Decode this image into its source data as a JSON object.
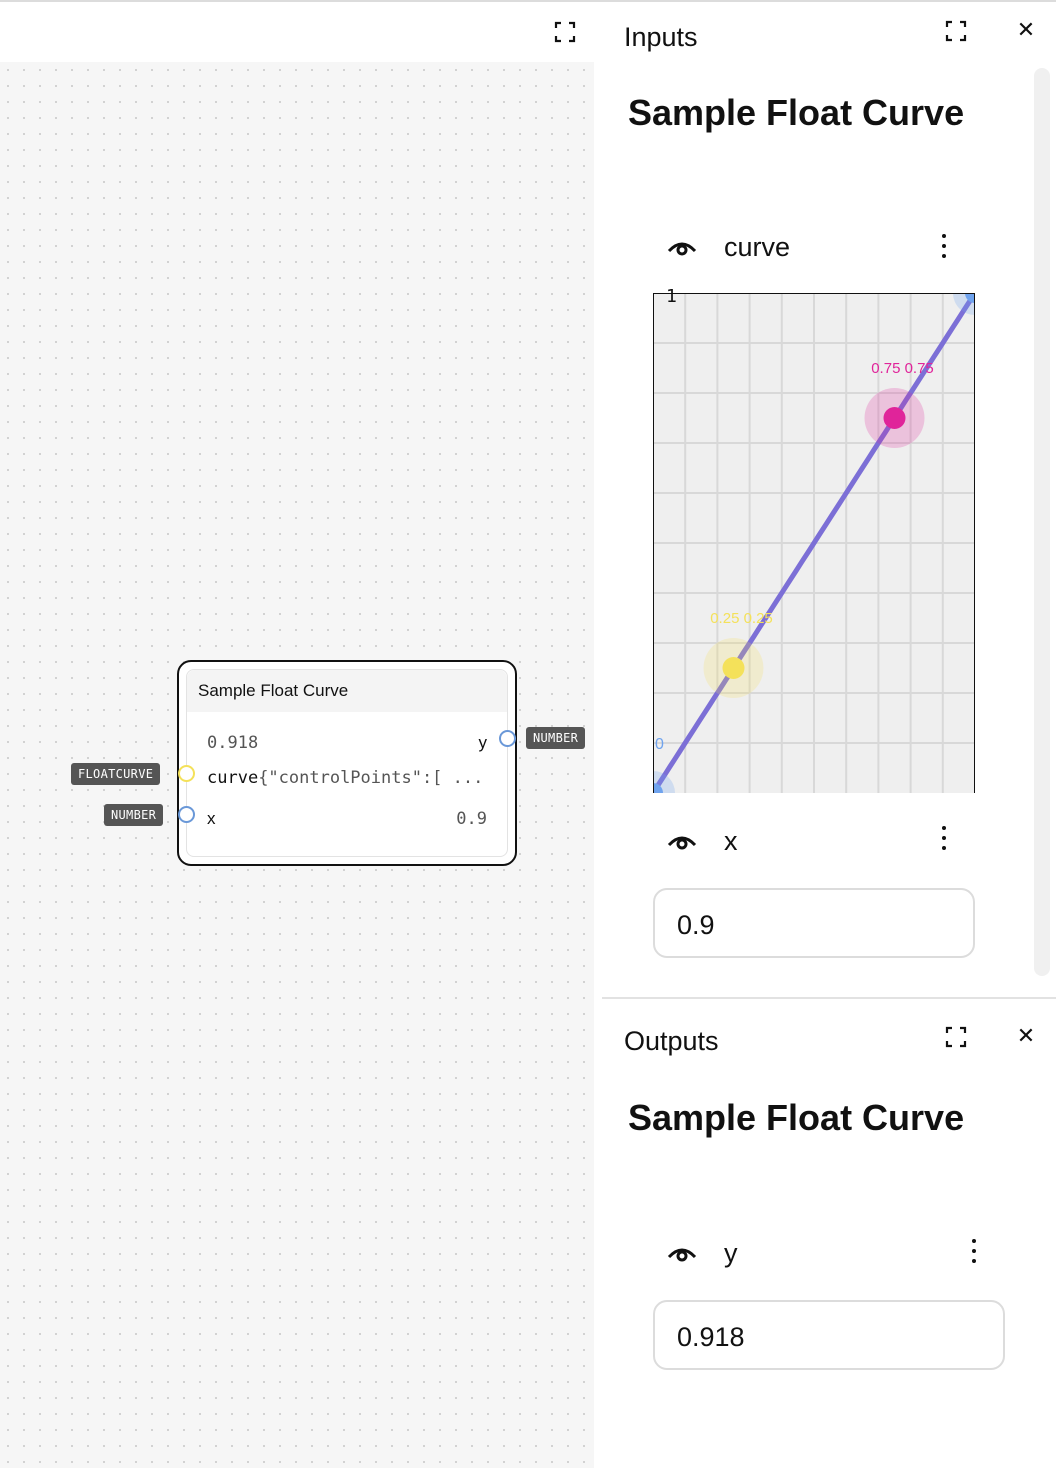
{
  "canvas": {
    "node": {
      "title": "Sample Float Curve",
      "output_value": "0.918",
      "output_name": "y",
      "output_type": "NUMBER",
      "curve_label": "curve",
      "curve_value": "{\"controlPoints\":[ ...",
      "curve_type": "FLOATCURVE",
      "x_label": "x",
      "x_value": "0.9",
      "x_type": "NUMBER"
    }
  },
  "inputs_panel": {
    "title": "Inputs",
    "heading": "Sample Float Curve",
    "curve_field": {
      "label": "curve",
      "axis_max_label": "1",
      "axis_min_label": "0",
      "points": [
        {
          "label": "0.25 0.25",
          "x": 0.25,
          "y": 0.25,
          "color": "#f4e15a"
        },
        {
          "label": "0.75 0.75",
          "x": 0.75,
          "y": 0.75,
          "color": "#e0249a"
        }
      ],
      "curve_color": "#7c6fd6",
      "endpoint_color": "#6fa3ee"
    },
    "x_field": {
      "label": "x",
      "value": "0.9"
    }
  },
  "outputs_panel": {
    "title": "Outputs",
    "heading": "Sample Float Curve",
    "y_field": {
      "label": "y",
      "value": "0.918"
    }
  },
  "colors": {
    "floatcurve_socket": "#f4e15a",
    "number_socket": "#6a98d8"
  }
}
